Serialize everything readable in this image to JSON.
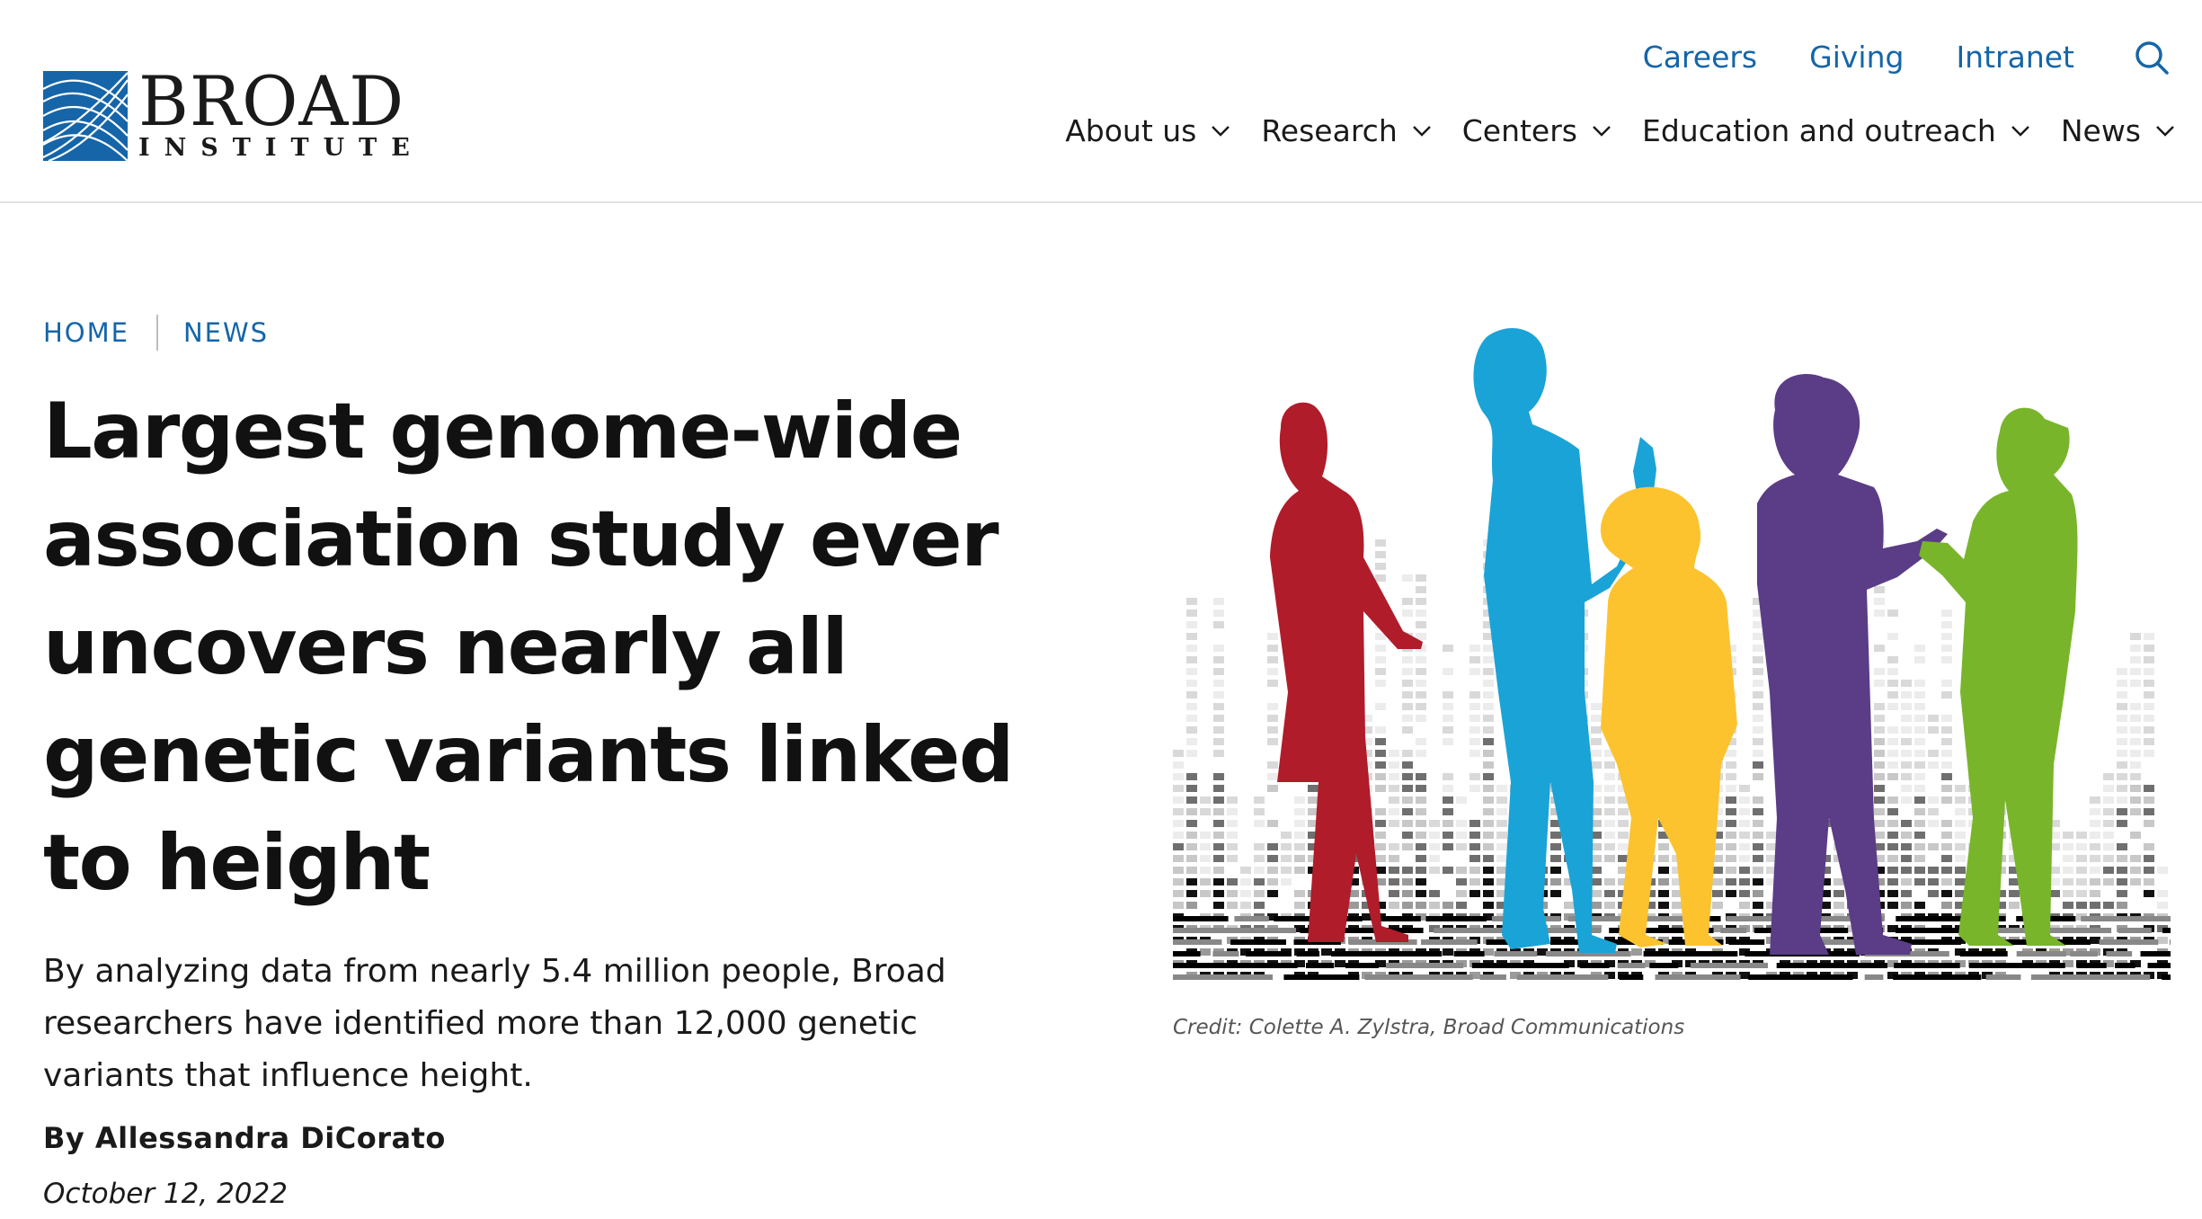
{
  "header": {
    "logo": {
      "word": "BROAD",
      "sub": "INSTITUTE",
      "brand_color": "#1565a8"
    },
    "utility_links": [
      "Careers",
      "Giving",
      "Intranet"
    ],
    "search_icon": "search-icon",
    "nav": [
      {
        "label": "About us"
      },
      {
        "label": "Research"
      },
      {
        "label": "Centers"
      },
      {
        "label": "Education and outreach"
      },
      {
        "label": "News"
      }
    ]
  },
  "breadcrumb": [
    "HOME",
    "NEWS"
  ],
  "article": {
    "title": "Largest genome-wide association study ever uncovers nearly all genetic variants linked to height",
    "dek": "By analyzing data from nearly 5.4 million people, Broad researchers have identified more than 12,000 genetic variants that influence height.",
    "byline": "By Allessandra DiCorato",
    "date": "October 12, 2022"
  },
  "hero": {
    "credit": "Credit: Colette A. Zylstra, Broad Communications",
    "figure_colors": [
      "#b01c2a",
      "#1aa3d6",
      "#fcc32e",
      "#5b3c87",
      "#78b52a"
    ]
  },
  "colors": {
    "link": "#1565a8",
    "text": "#1a1a1a",
    "divider": "#e2e2e2"
  }
}
